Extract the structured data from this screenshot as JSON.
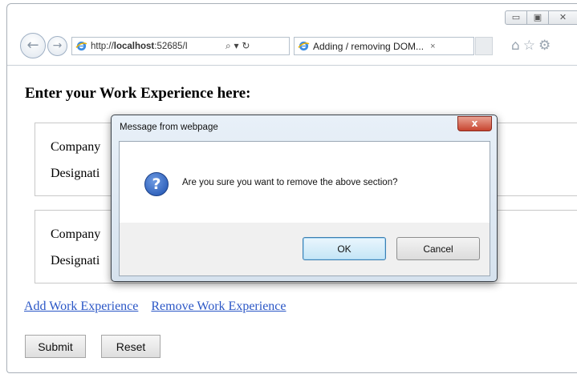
{
  "browser": {
    "caption_buttons": [
      "minimize",
      "maximize",
      "close"
    ],
    "address_prefix": "http://",
    "address_host": "localhost",
    "address_suffix": ":52685/I",
    "address_icons": "⌕ ▾ ↻",
    "tab_title": "Adding / removing DOM...",
    "tab_close": "×",
    "tool_icons": [
      "home-icon",
      "favorites-star-icon",
      "settings-gear-icon"
    ]
  },
  "page": {
    "heading": "Enter your Work Experience here:",
    "sections": [
      {
        "company_label": "Company",
        "designation_label": "Designati"
      },
      {
        "company_label": "Company",
        "designation_label": "Designati"
      }
    ],
    "add_link": "Add Work Experience",
    "remove_link": "Remove Work Experience",
    "submit_label": "Submit",
    "reset_label": "Reset"
  },
  "dialog": {
    "title": "Message from webpage",
    "close_glyph": "x",
    "icon": "question-icon",
    "message": "Are you sure you want to remove the above section?",
    "ok_label": "OK",
    "cancel_label": "Cancel"
  },
  "colors": {
    "link": "#2a56c6",
    "dialog_close": "#c7452f",
    "question_icon": "#1c4fae"
  }
}
